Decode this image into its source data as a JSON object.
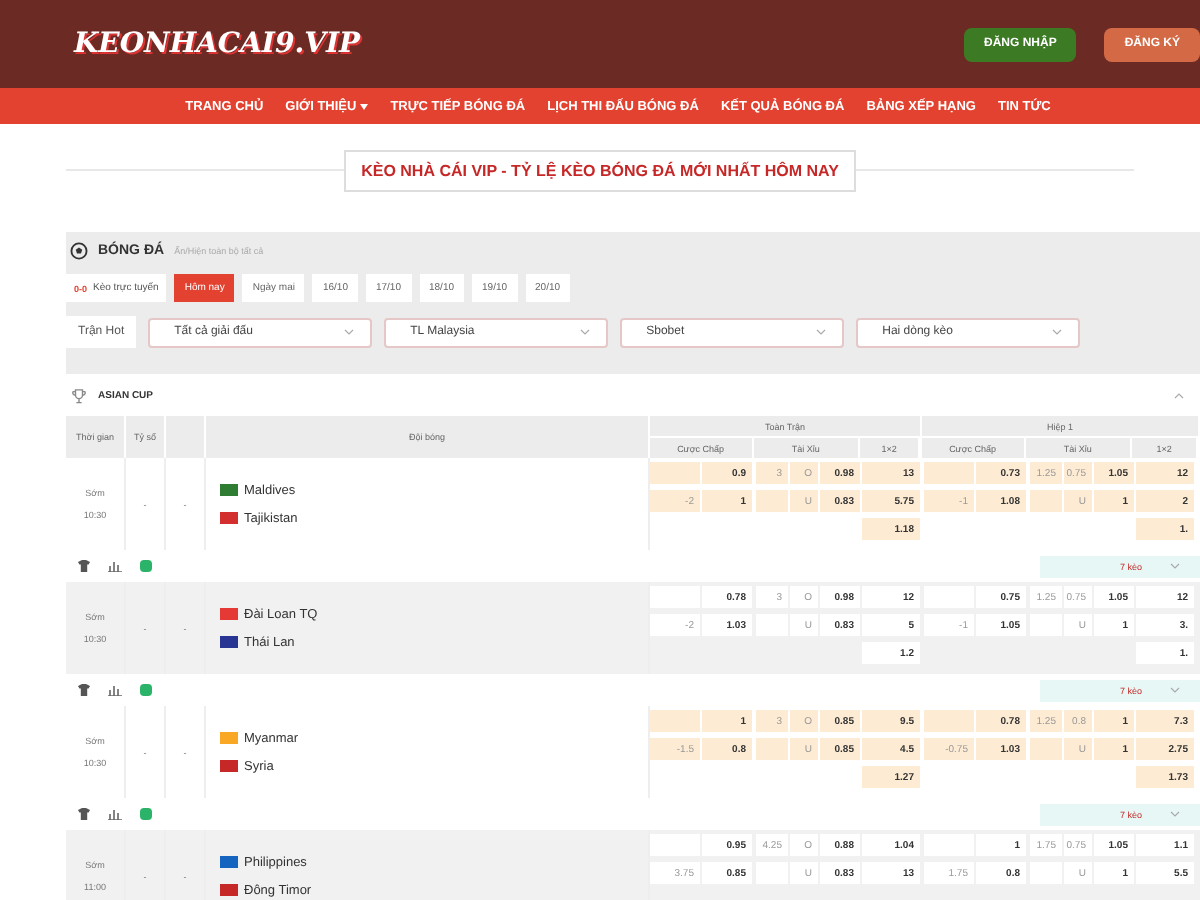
{
  "header": {
    "logo": "KEONHACAI9.VIP",
    "buttons": [
      {
        "label": "ĐĂNG NHẬP",
        "kind": "login"
      },
      {
        "label": "ĐĂNG KÝ",
        "kind": "register"
      }
    ]
  },
  "nav": [
    {
      "label": "TRANG CHỦ",
      "has_menu": false
    },
    {
      "label": "GIỚI THIỆU",
      "has_menu": true
    },
    {
      "label": "TRỰC TIẾP BÓNG ĐÁ",
      "has_menu": false
    },
    {
      "label": "LỊCH THI ĐẤU BÓNG ĐÁ",
      "has_menu": false
    },
    {
      "label": "KẾT QUẢ BÓNG ĐÁ",
      "has_menu": false
    },
    {
      "label": "BẢNG XẾP HẠNG",
      "has_menu": false
    },
    {
      "label": "TIN TỨC",
      "has_menu": false
    }
  ],
  "page_title": "KÈO NHÀ CÁI VIP - TỶ LỆ KÈO BÓNG ĐÁ MỚI NHẤT HÔM NAY",
  "sport": {
    "title": "BÓNG ĐÁ",
    "hint": "Ẩn/Hiện toàn bộ tất cả"
  },
  "live_link": {
    "badge": "0-0",
    "label": "Kèo trực tuyến"
  },
  "day_tabs": [
    {
      "label": "Hôm nay",
      "selected": true
    },
    {
      "label": "Ngày mai",
      "selected": false
    },
    {
      "label": "16/10",
      "selected": false
    },
    {
      "label": "17/10",
      "selected": false
    },
    {
      "label": "18/10",
      "selected": false
    },
    {
      "label": "19/10",
      "selected": false
    },
    {
      "label": "20/10",
      "selected": false
    }
  ],
  "filters": {
    "hot": "Trận Hot",
    "selects": [
      "Tất cả giải đấu",
      "TL Malaysia",
      "Sbobet",
      "Hai dòng kèo"
    ]
  },
  "league": {
    "name": "ASIAN CUP",
    "expanded": true
  },
  "columns": {
    "time": "Thời gian",
    "score": "Tỷ số",
    "teams": "Đội bóng",
    "groups": [
      {
        "title": "Toàn Trận",
        "sub": [
          "Cược Chấp",
          "Tài Xỉu",
          "1×2"
        ]
      },
      {
        "title": "Hiệp 1",
        "sub": [
          "Cược Chấp",
          "Tài Xỉu",
          "1×2"
        ]
      }
    ]
  },
  "matches": [
    {
      "status": "Sớm",
      "time": "10:30",
      "score": [
        "-",
        "-"
      ],
      "teams": [
        {
          "name": "Maldives",
          "color": "#2e7d32"
        },
        {
          "name": "Tajikistan",
          "color": "#d32f2f"
        }
      ],
      "full": {
        "handicap": [
          {
            "odds": "0.9"
          },
          {
            "line": "-2",
            "odds": "1"
          }
        ],
        "over_under": [
          {
            "line": "3",
            "side": "O",
            "odds": "0.98"
          },
          {
            "side": "U",
            "odds": "0.83"
          }
        ],
        "x12": [
          "13",
          "5.75",
          "1.18"
        ]
      },
      "half": {
        "handicap": [
          {
            "odds": "0.73"
          },
          {
            "line": "-1",
            "odds": "1.08"
          }
        ],
        "over_under": [
          {
            "line": "1.25",
            "side": "0.75",
            "odds": "1.05"
          },
          {
            "side": "U",
            "odds": "1"
          }
        ],
        "x12": [
          "12",
          "2",
          "1."
        ]
      },
      "more": "7 kèo"
    },
    {
      "status": "Sớm",
      "time": "10:30",
      "score": [
        "-",
        "-"
      ],
      "teams": [
        {
          "name": "Đài Loan TQ",
          "color": "#e53935"
        },
        {
          "name": "Thái Lan",
          "color": "#283593"
        }
      ],
      "full": {
        "handicap": [
          {
            "odds": "0.78"
          },
          {
            "line": "-2",
            "odds": "1.03"
          }
        ],
        "over_under": [
          {
            "line": "3",
            "side": "O",
            "odds": "0.98"
          },
          {
            "side": "U",
            "odds": "0.83"
          }
        ],
        "x12": [
          "12",
          "5",
          "1.2"
        ]
      },
      "half": {
        "handicap": [
          {
            "odds": "0.75"
          },
          {
            "line": "-1",
            "odds": "1.05"
          }
        ],
        "over_under": [
          {
            "line": "1.25",
            "side": "0.75",
            "odds": "1.05"
          },
          {
            "side": "U",
            "odds": "1"
          }
        ],
        "x12": [
          "12",
          "3.",
          "1."
        ]
      },
      "more": "7 kèo"
    },
    {
      "status": "Sớm",
      "time": "10:30",
      "score": [
        "-",
        "-"
      ],
      "teams": [
        {
          "name": "Myanmar",
          "color": "#f9a825"
        },
        {
          "name": "Syria",
          "color": "#c62828"
        }
      ],
      "full": {
        "handicap": [
          {
            "odds": "1"
          },
          {
            "line": "-1.5",
            "odds": "0.8"
          }
        ],
        "over_under": [
          {
            "line": "3",
            "side": "O",
            "odds": "0.85"
          },
          {
            "side": "U",
            "odds": "0.85"
          }
        ],
        "x12": [
          "9.5",
          "4.5",
          "1.27"
        ]
      },
      "half": {
        "handicap": [
          {
            "odds": "0.78"
          },
          {
            "line": "-0.75",
            "odds": "1.03"
          }
        ],
        "over_under": [
          {
            "line": "1.25",
            "side": "0.8",
            "odds": "1"
          },
          {
            "side": "U",
            "odds": "1"
          }
        ],
        "x12": [
          "7.3",
          "2.75",
          "1.73"
        ]
      },
      "more": "7 kèo"
    },
    {
      "status": "Sớm",
      "time": "11:00",
      "score": [
        "-",
        "-"
      ],
      "teams": [
        {
          "name": "Philippines",
          "color": "#1565c0"
        },
        {
          "name": "Đông Timor",
          "color": "#c62828"
        }
      ],
      "full": {
        "handicap": [
          {
            "odds": "0.95"
          },
          {
            "line": "3.75",
            "odds": "0.85"
          }
        ],
        "over_under": [
          {
            "line": "4.25",
            "side": "O",
            "odds": "0.88"
          },
          {
            "side": "U",
            "odds": "0.83"
          }
        ],
        "x12": [
          "1.04",
          "13"
        ]
      },
      "half": {
        "handicap": [
          {
            "odds": "1"
          },
          {
            "line": "1.75",
            "odds": "0.8"
          }
        ],
        "over_under": [
          {
            "line": "1.75",
            "side": "0.75",
            "odds": "1.05"
          },
          {
            "side": "U",
            "odds": "1"
          }
        ],
        "x12": [
          "1.1",
          "5.5"
        ]
      }
    }
  ]
}
